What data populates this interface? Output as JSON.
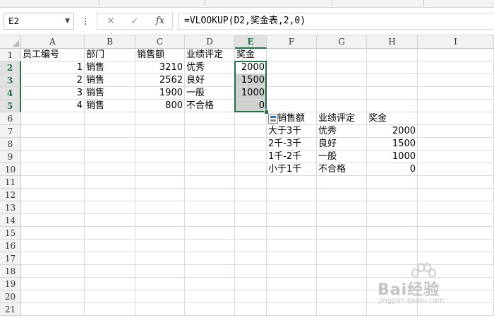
{
  "name_box": "E2",
  "formula": "=VLOOKUP(D2,奖金表,2,0)",
  "formula_buttons": {
    "cancel": "✕",
    "enter": "✓",
    "fx": "fx"
  },
  "columns": [
    "A",
    "B",
    "C",
    "D",
    "E",
    "F",
    "G",
    "H",
    "I"
  ],
  "selected_column": "E",
  "rows": [
    "1",
    "2",
    "3",
    "4",
    "5",
    "6",
    "7",
    "8",
    "9",
    "10",
    "11",
    "12",
    "13",
    "14",
    "15",
    "16",
    "17",
    "18",
    "19",
    "20",
    "21"
  ],
  "selected_rows": [
    "2",
    "3",
    "4",
    "5"
  ],
  "cells": {
    "A1": "员工编号",
    "B1": "部门",
    "C1": "销售额",
    "D1": "业绩评定",
    "E1": "奖金",
    "A2": "1",
    "B2": "销售",
    "C2": "3210",
    "D2": "优秀",
    "E2": "2000",
    "A3": "2",
    "B3": "销售",
    "C3": "2562",
    "D3": "良好",
    "E3": "1500",
    "A4": "3",
    "B4": "销售",
    "C4": "1900",
    "D4": "一般",
    "E4": "1000",
    "A5": "4",
    "B5": "销售",
    "C5": "800",
    "D5": "不合格",
    "E5": "0",
    "F6": "销售额",
    "G6": "业绩评定",
    "H6": "奖金",
    "F7": "大于3千",
    "G7": "优秀",
    "H7": "2000",
    "F8": "2千-3千",
    "G8": "良好",
    "H8": "1500",
    "F9": "1千-2千",
    "G9": "一般",
    "H9": "1000",
    "F10": "小于1千",
    "G10": "不合格",
    "H10": "0"
  },
  "watermark": {
    "brand": "Bai经验",
    "url": "jingyan.baidu.com"
  }
}
